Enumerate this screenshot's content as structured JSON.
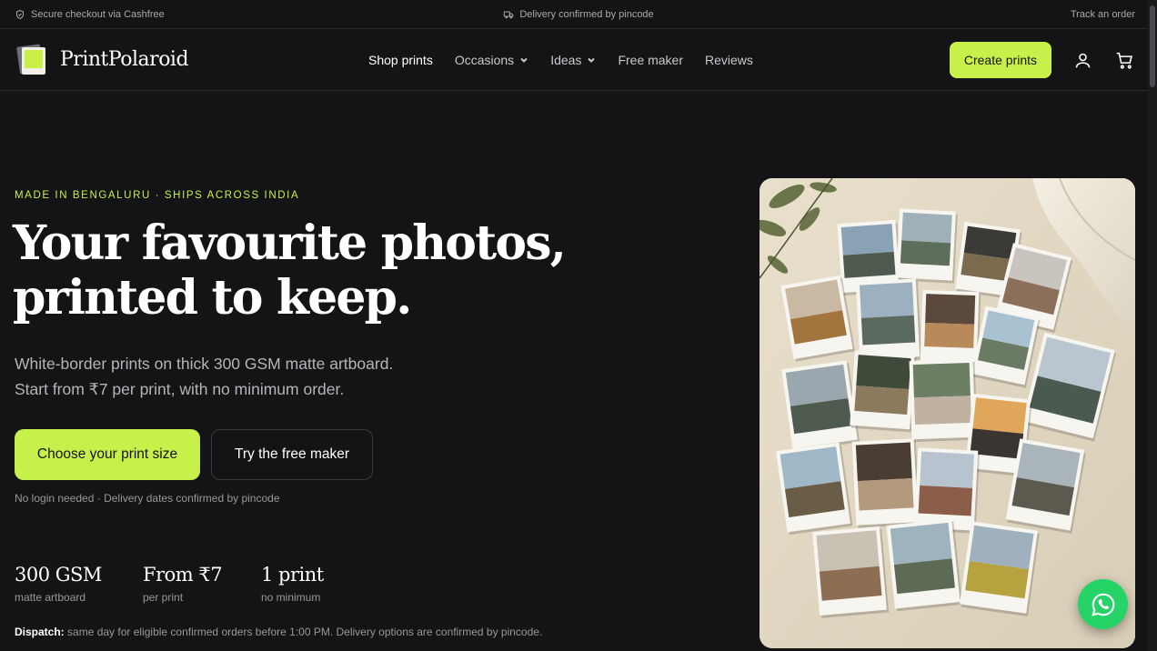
{
  "topbar": {
    "secure": "Secure checkout via Cashfree",
    "delivery": "Delivery confirmed by pincode",
    "track": "Track an order"
  },
  "header": {
    "brand": "PrintPolaroid",
    "nav": [
      {
        "label": "Shop prints"
      },
      {
        "label": "Occasions"
      },
      {
        "label": "Ideas"
      },
      {
        "label": "Free maker"
      },
      {
        "label": "Reviews"
      }
    ],
    "create_label": "Create prints",
    "account_icon": "user-icon",
    "cart_icon": "cart-icon"
  },
  "hero": {
    "eyebrow": "MADE IN BENGALURU · SHIPS ACROSS INDIA",
    "headline_line1": "Your favourite photos,",
    "headline_line2": "printed to keep.",
    "sub_line1": "White-border prints on thick 300 GSM matte artboard.",
    "sub_line2": "Start from ₹7 per print, with no minimum order.",
    "primary_cta": "Choose your print size",
    "secondary_cta": "Try the free maker",
    "note": "No login needed · Delivery dates confirmed by pincode",
    "stats": [
      {
        "value": "300 GSM",
        "label": "matte artboard"
      },
      {
        "value": "From ₹7",
        "label": "per print"
      },
      {
        "value": "1 print",
        "label": "no minimum"
      }
    ],
    "dispatch_label": "Dispatch:",
    "dispatch_text": "same day for eligible confirmed orders before 1:00 PM. Delivery options are confirmed by pincode."
  },
  "colors": {
    "accent": "#c8f04a",
    "background": "#141416",
    "whatsapp": "#25d366"
  }
}
